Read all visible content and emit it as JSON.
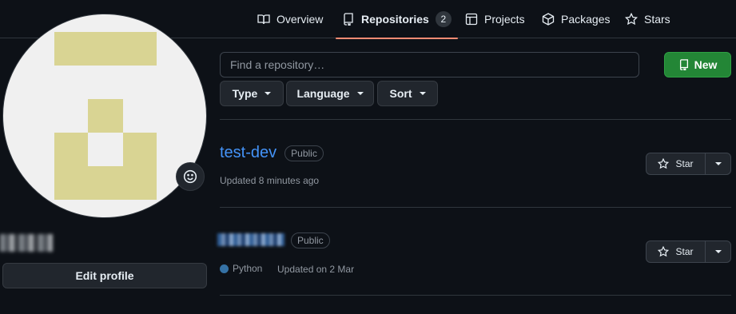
{
  "nav": {
    "tabs": [
      {
        "label": "Overview",
        "icon": "book-open-icon"
      },
      {
        "label": "Repositories",
        "icon": "repo-icon",
        "count": "2",
        "active": true
      },
      {
        "label": "Projects",
        "icon": "table-icon"
      },
      {
        "label": "Packages",
        "icon": "package-icon"
      },
      {
        "label": "Stars",
        "icon": "star-icon"
      }
    ]
  },
  "profile": {
    "avatar_bg": "#f0f0f0",
    "avatar_fg": "#d9d493",
    "edit_label": "Edit profile"
  },
  "search": {
    "placeholder": "Find a repository…",
    "value": ""
  },
  "filters": {
    "type": "Type",
    "language": "Language",
    "sort": "Sort"
  },
  "new_button": {
    "label": "New"
  },
  "repos": [
    {
      "name": "test-dev",
      "visibility": "Public",
      "updated": "Updated 8 minutes ago",
      "star_label": "Star"
    },
    {
      "visibility": "Public",
      "language": "Python",
      "language_color": "#3572A5",
      "updated": "Updated on 2 Mar",
      "star_label": "Star"
    }
  ],
  "colors": {
    "background": "#0d1117",
    "accent_link": "#4493f8",
    "tab_underline": "#fd8c73",
    "new_button": "#238636"
  }
}
